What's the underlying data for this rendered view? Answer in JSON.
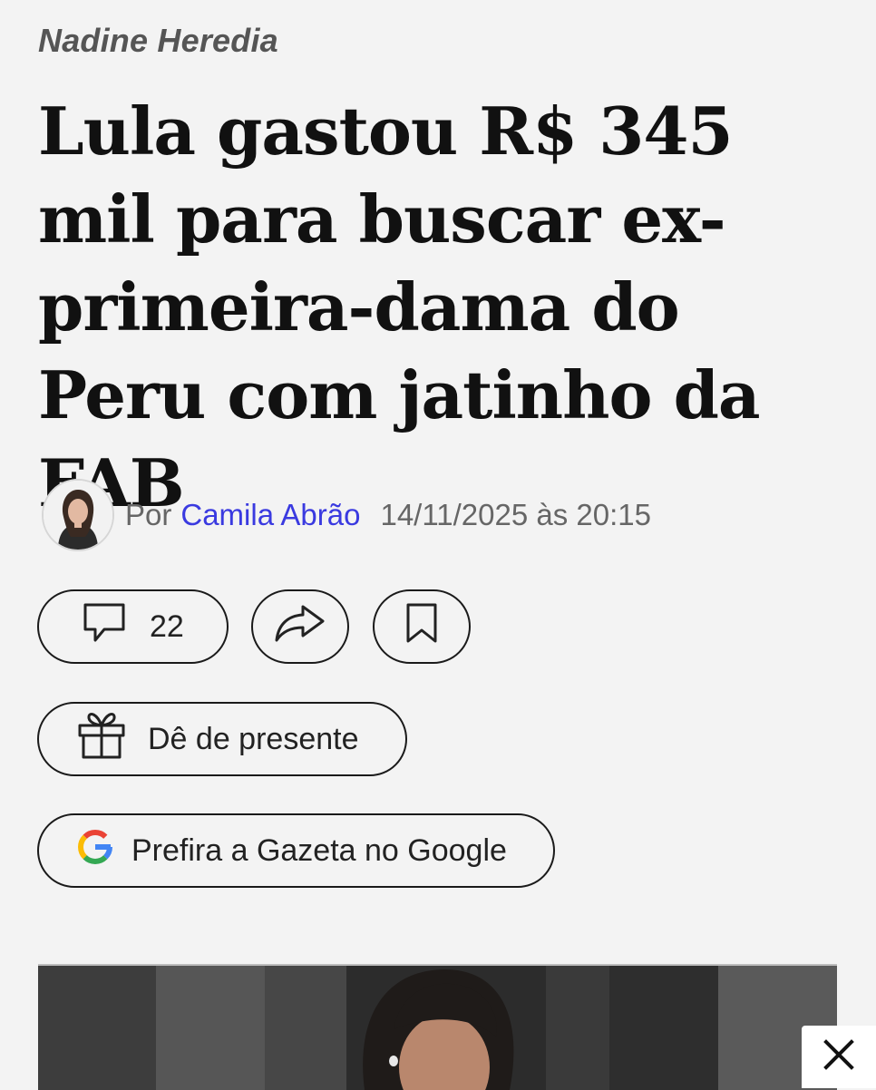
{
  "article": {
    "kicker": "Nadine Heredia",
    "headline": "Lula gastou R$ 345 mil para buscar ex-primeira-dama do Peru com jatinho da FAB",
    "byline": {
      "prefix": "Por",
      "author": "Camila Abrão",
      "date": "14/11/2025 às 20:15"
    }
  },
  "actions": {
    "comments_count": "22",
    "gift_label": "Dê de presente",
    "google_label": "Prefira a Gazeta no Google"
  },
  "colors": {
    "background": "#f3f3f3",
    "author_link": "#3a3ae0",
    "kicker": "#555555"
  },
  "icons": {
    "comments": "comment-bubble-icon",
    "share": "share-arrow-icon",
    "save": "bookmark-icon",
    "gift": "gift-icon",
    "google": "google-g-icon",
    "close": "close-icon"
  }
}
